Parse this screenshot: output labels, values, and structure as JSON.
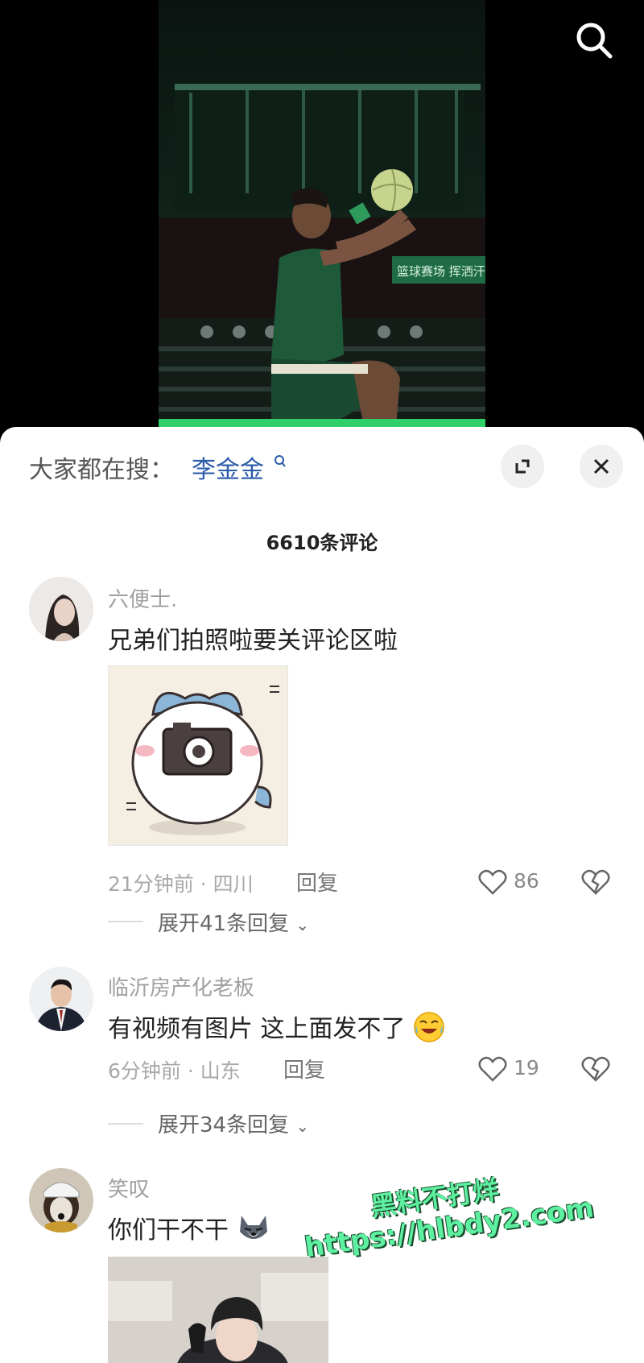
{
  "header": {
    "hot_search_label": "大家都在搜：",
    "hot_search_term": "李金金"
  },
  "comments_header": {
    "count_label": "6610条评论"
  },
  "comments": [
    {
      "username": "六便士.",
      "text": "兄弟们拍照啦要关评论区啦",
      "meta": "21分钟前 · 四川",
      "reply_label": "回复",
      "likes": "86",
      "expand_label": "展开41条回复"
    },
    {
      "username": "临沂房产化老板",
      "text": "有视频有图片 这上面发不了",
      "meta": "6分钟前 · 山东",
      "reply_label": "回复",
      "likes": "19",
      "expand_label": "展开34条回复"
    },
    {
      "username": "笑叹",
      "text": "你们干不干"
    }
  ],
  "video": {
    "banner_text": "篮球赛场 挥洒汗"
  },
  "watermark": {
    "line1": "黑料不打烊",
    "line2": "https://hlbdy2.com"
  },
  "colors": {
    "accent": "#2a5aa8",
    "sheet_bg": "#ffffff",
    "video_bg": "#000000",
    "watermark": "#5df0a0"
  }
}
